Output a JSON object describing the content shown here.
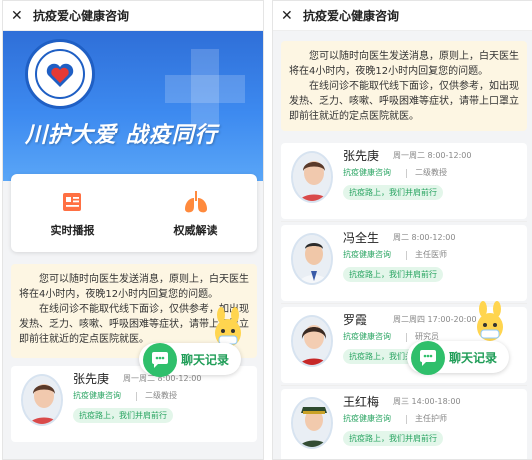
{
  "app_title": "抗疫爱心健康咨询",
  "banner": {
    "slogan": "川护大爱 战疫同行"
  },
  "features": [
    {
      "label": "实时播报",
      "icon": "newspaper-icon"
    },
    {
      "label": "权威解读",
      "icon": "lungs-icon"
    }
  ],
  "notice": {
    "para1": "您可以随时向医生发送消息，原则上，白天医生将在4小时内，夜晚12小时内回复您的问题。",
    "para2": "在线问诊不能取代线下面诊，仅供参考，如出现发热、乏力、咳嗽、呼吸困难等症状，请带上口罩立即前往就近的定点医院就医。"
  },
  "doctors": [
    {
      "name": "张先庚",
      "time": "周一周二 8:00-12:00",
      "tag": "抗疫健康咨询",
      "title": "二级教授",
      "slogan": "抗疫路上，我们并肩前行"
    },
    {
      "name": "冯全生",
      "time": "周二 8:00-12:00",
      "tag": "抗疫健康咨询",
      "title": "主任医师",
      "slogan": "抗疫路上，我们并肩前行"
    },
    {
      "name": "罗霞",
      "time": "周二周四 17:00-20:00",
      "tag": "抗疫健康咨询",
      "title": "研究员",
      "slogan": "抗疫路上，我们并肩前行"
    },
    {
      "name": "王红梅",
      "time": "周三 14:00-18:00",
      "tag": "抗疫健康咨询",
      "title": "主任护师",
      "slogan": "抗疫路上，我们并肩前行"
    }
  ],
  "chat_button": {
    "label": "聊天记录"
  },
  "colors": {
    "brand_blue": "#2f6fd8",
    "accent_green": "#2ba563",
    "notice_bg": "#fdf6e3"
  }
}
